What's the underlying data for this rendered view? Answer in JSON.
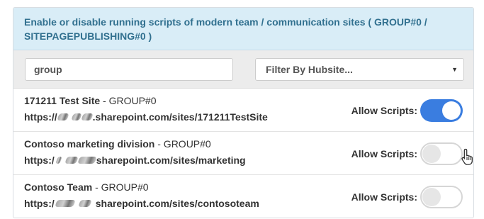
{
  "panel": {
    "heading": "Enable or disable running scripts of modern team / communication sites ( GROUP#0 / SITEPAGEPUBLISHING#0 )"
  },
  "filters": {
    "search_value": "group",
    "hub_select_selected": "Filter By Hubsite..."
  },
  "sites": [
    {
      "name": "171211 Test Site",
      "group_suffix": " - GROUP#0",
      "url_prefix": "https://",
      "url_suffix": ".sharepoint.com/sites/171211TestSite",
      "allow_label": "Allow Scripts:",
      "scripts_allowed": true
    },
    {
      "name": "Contoso marketing division",
      "group_suffix": " - GROUP#0",
      "url_prefix": "https:/",
      "url_suffix": "sharepoint.com/sites/marketing",
      "allow_label": "Allow Scripts:",
      "scripts_allowed": false
    },
    {
      "name": "Contoso Team",
      "group_suffix": " - GROUP#0",
      "url_prefix": "https:/",
      "url_suffix": "sharepoint.com/sites/contosoteam",
      "allow_label": "Allow Scripts:",
      "scripts_allowed": false
    }
  ],
  "icons": {
    "select_caret": "chevron-down-icon",
    "mouse_cursor": "hand-pointer-icon"
  },
  "colors": {
    "heading_bg": "#d9edf7",
    "heading_text": "#31708f",
    "toggle_on": "#3a7de0",
    "toggle_off_border": "#d6d6d6"
  }
}
